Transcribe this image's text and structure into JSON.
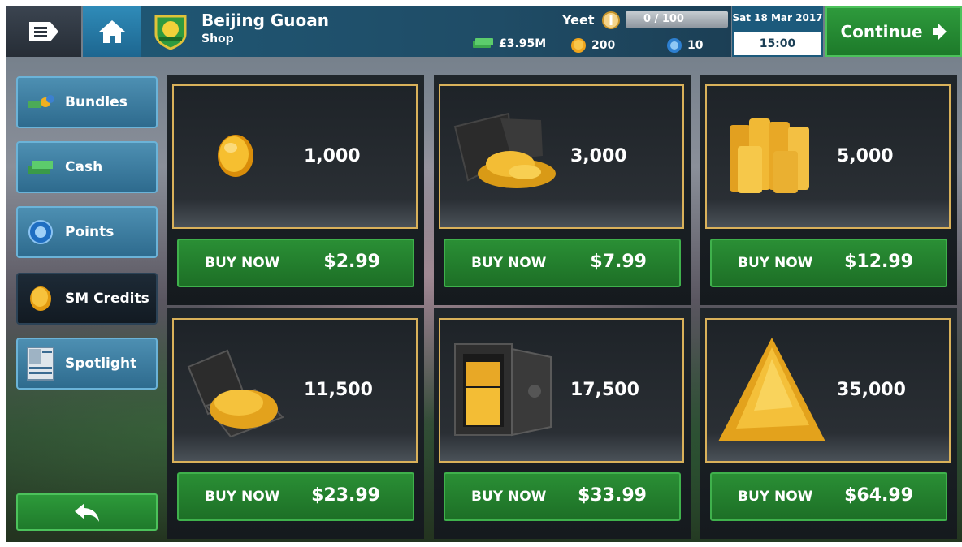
{
  "header": {
    "club_name": "Beijing Guoan",
    "page_name": "Shop",
    "cash": "£3.95M",
    "credits": "200",
    "points": "10",
    "user_name": "Yeet",
    "xp": "0 / 100",
    "date": "Sat 18 Mar 2017",
    "time": "15:00",
    "continue_label": "Continue"
  },
  "sidebar": {
    "items": [
      {
        "label": "Bundles",
        "icon": "bundles-icon"
      },
      {
        "label": "Cash",
        "icon": "cash-icon"
      },
      {
        "label": "Points",
        "icon": "points-icon"
      },
      {
        "label": "SM Credits",
        "icon": "credits-coin-icon",
        "active": true
      },
      {
        "label": "Spotlight",
        "icon": "spotlight-icon"
      }
    ],
    "back_icon": "back-arrow-icon"
  },
  "shop": {
    "items": [
      {
        "amount": "1,000",
        "buy_label": "BUY NOW",
        "price": "$2.99",
        "art": "single-coin"
      },
      {
        "amount": "3,000",
        "buy_label": "BUY NOW",
        "price": "$7.99",
        "art": "wallet-coins"
      },
      {
        "amount": "5,000",
        "buy_label": "BUY NOW",
        "price": "$12.99",
        "art": "coin-stacks"
      },
      {
        "amount": "11,500",
        "buy_label": "BUY NOW",
        "price": "$23.99",
        "art": "briefcase-coins"
      },
      {
        "amount": "17,500",
        "buy_label": "BUY NOW",
        "price": "$33.99",
        "art": "safe-coins"
      },
      {
        "amount": "35,000",
        "buy_label": "BUY NOW",
        "price": "$64.99",
        "art": "coin-mountain"
      }
    ]
  },
  "colors": {
    "accent_green": "#2a8f35",
    "frame_gold": "#d9b15a",
    "header_blue": "#1f5673"
  }
}
